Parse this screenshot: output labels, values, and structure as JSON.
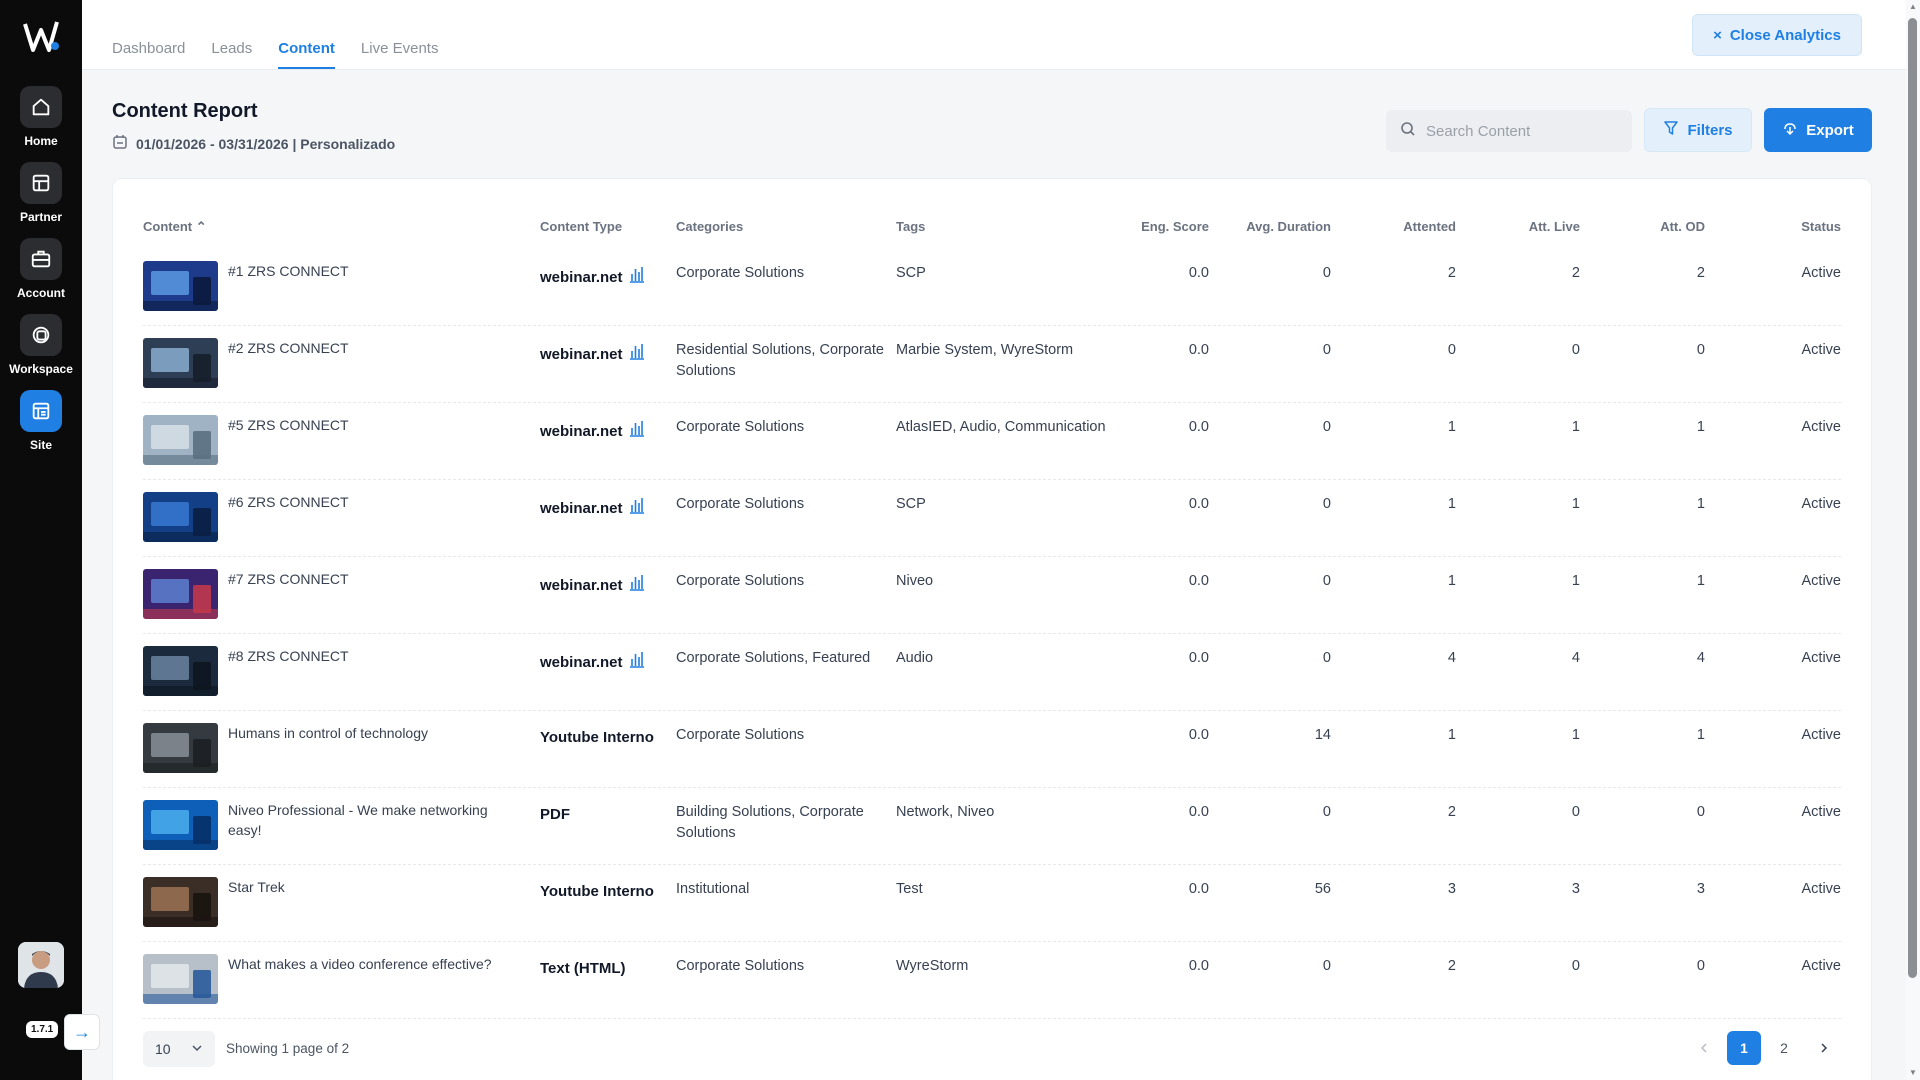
{
  "sidebar": {
    "items": [
      {
        "label": "Home",
        "icon": "home-icon"
      },
      {
        "label": "Partner",
        "icon": "partner-icon"
      },
      {
        "label": "Account",
        "icon": "briefcase-icon"
      },
      {
        "label": "Workspace",
        "icon": "workspace-icon"
      },
      {
        "label": "Site",
        "icon": "site-icon",
        "active": true
      }
    ],
    "version": "1.7.1"
  },
  "tabs": [
    "Dashboard",
    "Leads",
    "Content",
    "Live Events"
  ],
  "active_tab": "Content",
  "close_analytics_label": "Close Analytics",
  "report": {
    "title": "Content Report",
    "date_range": "01/01/2026 - 03/31/2026 | Personalizado"
  },
  "search": {
    "placeholder": "Search Content"
  },
  "filters_label": "Filters",
  "export_label": "Export",
  "columns": {
    "content": "Content",
    "content_type": "Content Type",
    "categories": "Categories",
    "tags": "Tags",
    "eng_score": "Eng. Score",
    "avg_duration": "Avg. Duration",
    "attended": "Attented",
    "att_live": "Att. Live",
    "att_od": "Att. OD",
    "status": "Status"
  },
  "rows": [
    {
      "title": "#1 ZRS CONNECT",
      "type": "webinar.net",
      "categories": "Corporate Solutions",
      "tags": "SCP",
      "eng": "0.0",
      "dur": "0",
      "att": "2",
      "live": "2",
      "od": "2",
      "status": "Active"
    },
    {
      "title": "#2 ZRS CONNECT",
      "type": "webinar.net",
      "categories": "Residential Solutions, Corporate Solutions",
      "tags": "Marbie System, WyreStorm",
      "eng": "0.0",
      "dur": "0",
      "att": "0",
      "live": "0",
      "od": "0",
      "status": "Active"
    },
    {
      "title": "#5 ZRS CONNECT",
      "type": "webinar.net",
      "categories": "Corporate Solutions",
      "tags": "AtlasIED, Audio, Communication",
      "eng": "0.0",
      "dur": "0",
      "att": "1",
      "live": "1",
      "od": "1",
      "status": "Active"
    },
    {
      "title": "#6 ZRS CONNECT",
      "type": "webinar.net",
      "categories": "Corporate Solutions",
      "tags": "SCP",
      "eng": "0.0",
      "dur": "0",
      "att": "1",
      "live": "1",
      "od": "1",
      "status": "Active"
    },
    {
      "title": "#7 ZRS CONNECT",
      "type": "webinar.net",
      "categories": "Corporate Solutions",
      "tags": "Niveo",
      "eng": "0.0",
      "dur": "0",
      "att": "1",
      "live": "1",
      "od": "1",
      "status": "Active"
    },
    {
      "title": "#8 ZRS CONNECT",
      "type": "webinar.net",
      "categories": "Corporate Solutions, Featured",
      "tags": "Audio",
      "eng": "0.0",
      "dur": "0",
      "att": "4",
      "live": "4",
      "od": "4",
      "status": "Active"
    },
    {
      "title": "Humans in control of technology",
      "type": "Youtube Interno",
      "categories": "Corporate Solutions",
      "tags": "",
      "eng": "0.0",
      "dur": "14",
      "att": "1",
      "live": "1",
      "od": "1",
      "status": "Active"
    },
    {
      "title": "Niveo Professional - We make networking easy!",
      "type": "PDF",
      "categories": "Building Solutions, Corporate Solutions",
      "tags": "Network, Niveo",
      "eng": "0.0",
      "dur": "0",
      "att": "2",
      "live": "0",
      "od": "0",
      "status": "Active"
    },
    {
      "title": "Star Trek",
      "type": "Youtube Interno",
      "categories": "Institutional",
      "tags": "Test",
      "eng": "0.0",
      "dur": "56",
      "att": "3",
      "live": "3",
      "od": "3",
      "status": "Active"
    },
    {
      "title": "What makes a video conference effective?",
      "type": "Text (HTML)",
      "categories": "Corporate Solutions",
      "tags": "WyreStorm",
      "eng": "0.0",
      "dur": "0",
      "att": "2",
      "live": "0",
      "od": "0",
      "status": "Active"
    }
  ],
  "pagination": {
    "page_size": "10",
    "info": "Showing 1 page of 2",
    "pages": [
      "1",
      "2"
    ],
    "current": "1"
  },
  "colors": {
    "accent": "#1f7fe3",
    "sidebar_bg": "#0b0b0c"
  }
}
